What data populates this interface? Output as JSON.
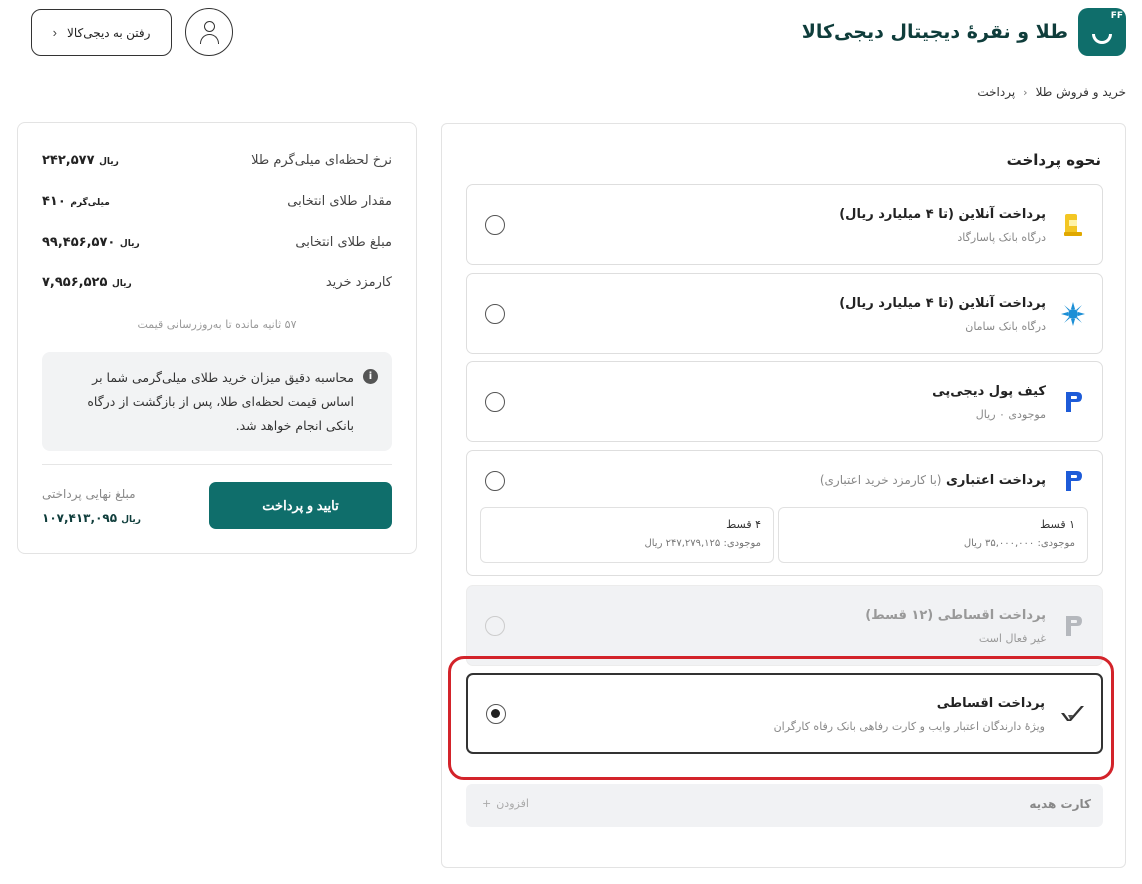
{
  "header": {
    "brand_title": "طلا و نقرۀ دیجیتال دیجی‌کالا",
    "brand_badge": "FF",
    "goto_button": "رفتن به دیجی‌کالا",
    "goto_chevron": "‹",
    "brand_color": "#0f6e6b"
  },
  "breadcrumb": {
    "items": [
      "خرید و فروش طلا",
      "پرداخت"
    ],
    "separator": "‹"
  },
  "payment": {
    "title": "نحوه پرداخت",
    "options": [
      {
        "title": "پرداخت آنلاین (تا ۴ میلیارد ریال)",
        "subtitle": "درگاه بانک پاسارگاد",
        "icon": "pasargad-bank-icon"
      },
      {
        "title": "پرداخت آنلاین (تا ۴ میلیارد ریال)",
        "subtitle": "درگاه بانک سامان",
        "icon": "saman-bank-icon"
      },
      {
        "title": "کیف پول دیجی‌پی",
        "subtitle": "موجودی ۰ ریال",
        "icon": "digipay-icon"
      },
      {
        "title": "پرداخت اعتباری",
        "title_note": "(با کارمزد خرید اعتباری)",
        "icon": "digipay-icon",
        "installments": [
          {
            "label": "۱ قسط",
            "balance": "موجودی: ۳۵,۰۰۰,۰۰۰ ریال"
          },
          {
            "label": "۴ قسط",
            "balance": "موجودی: ۲۴۷,۲۷۹,۱۲۵ ریال"
          }
        ]
      },
      {
        "title": "پرداخت اقساطی (۱۲ قسط)",
        "subtitle": "غیر فعال است",
        "icon": "digipay-icon",
        "disabled": true
      },
      {
        "title": "پرداخت اقساطی",
        "subtitle": "ویژۀ دارندگان اعتبار وایب و کارت رفاهی بانک رفاه کارگران",
        "icon": "vibe-icon",
        "selected": true
      }
    ],
    "gift_card": {
      "label": "کارت هدیه",
      "add": "افزودن",
      "add_icon": "+"
    },
    "highlight_color": "#d3232a"
  },
  "summary": {
    "rows": [
      {
        "label": "نرخ لحظه‌ای میلی‌گرم طلا",
        "value": "۲۴۲,۵۷۷",
        "unit": "ریال"
      },
      {
        "label": "مقدار طلای انتخابی",
        "value": "۴۱۰",
        "unit": "میلی‌گرم"
      },
      {
        "label": "مبلغ طلای انتخابی",
        "value": "۹۹,۴۵۶,۵۷۰",
        "unit": "ریال"
      },
      {
        "label": "کارمزد خرید",
        "value": "۷,۹۵۶,۵۲۵",
        "unit": "ریال"
      }
    ],
    "timer": "۵۷ ثانیه مانده تا به‌روزرسانی قیمت",
    "info_icon": "i",
    "info_text": "محاسبه دقیق میزان خرید طلای میلی‌گرمی شما بر اساس قیمت لحظه‌ای طلا، پس از بازگشت از درگاه بانکی انجام خواهد شد.",
    "final_label": "مبلغ نهایی پرداختی",
    "final_value": "۱۰۷,۴۱۳,۰۹۵",
    "final_unit": "ریال",
    "confirm_button": "تایید و پرداخت"
  }
}
